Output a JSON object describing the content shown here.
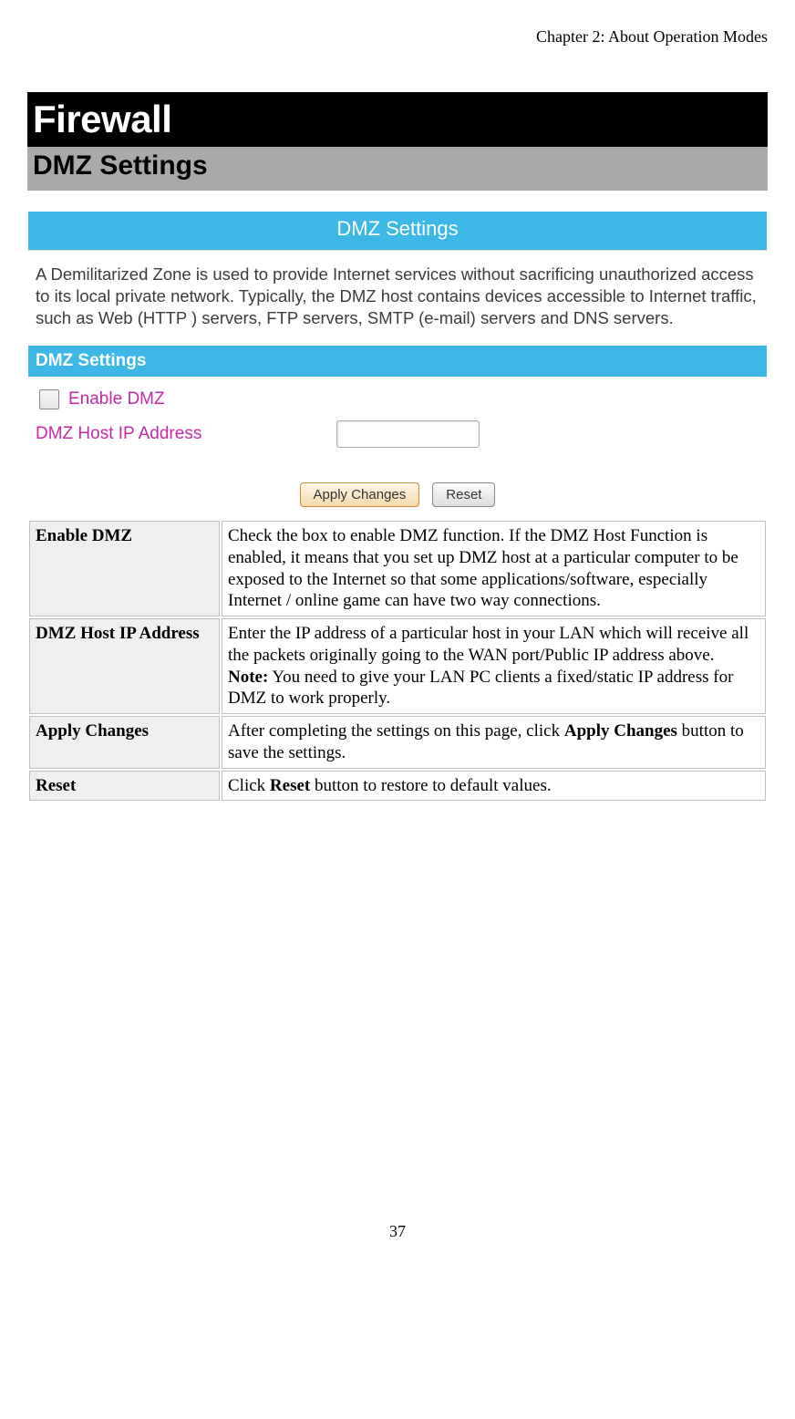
{
  "chapter_header": "Chapter 2: About Operation Modes",
  "title": "Firewall",
  "subtitle": "DMZ Settings",
  "screenshot": {
    "panel_title": "DMZ Settings",
    "description": "A Demilitarized Zone is used to provide Internet services without sacrificing unauthorized access to its local private network. Typically, the DMZ host contains devices accessible to Internet traffic, such as Web (HTTP ) servers, FTP servers, SMTP (e-mail) servers and DNS servers.",
    "section_bar": "DMZ Settings",
    "enable_label": "Enable DMZ",
    "host_label": "DMZ Host IP Address",
    "host_value": "",
    "apply_btn": "Apply Changes",
    "reset_btn": "Reset"
  },
  "rows": [
    {
      "term": "Enable DMZ",
      "desc": "Check the box to enable DMZ function. If the DMZ Host Function is enabled, it means that you set up DMZ host at a particular computer to be exposed to the Internet so that some applications/software, especially Internet / online game can have two way connections."
    },
    {
      "term": "DMZ Host IP Address",
      "desc_pre": "Enter the IP address of a particular host in your LAN which will receive all the packets originally going to the WAN port/Public IP address above.",
      "note_label": "Note:",
      "note_text": " You need to give your LAN PC clients a fixed/static IP address for DMZ to work properly."
    },
    {
      "term": "Apply Changes",
      "desc_pre": "After completing the settings on this page, click ",
      "bold": "Apply Changes",
      "desc_post": " button to save the settings."
    },
    {
      "term": "Reset",
      "desc_pre": "Click ",
      "bold": "Reset",
      "desc_post": " button to restore to default values."
    }
  ],
  "page_number": "37"
}
